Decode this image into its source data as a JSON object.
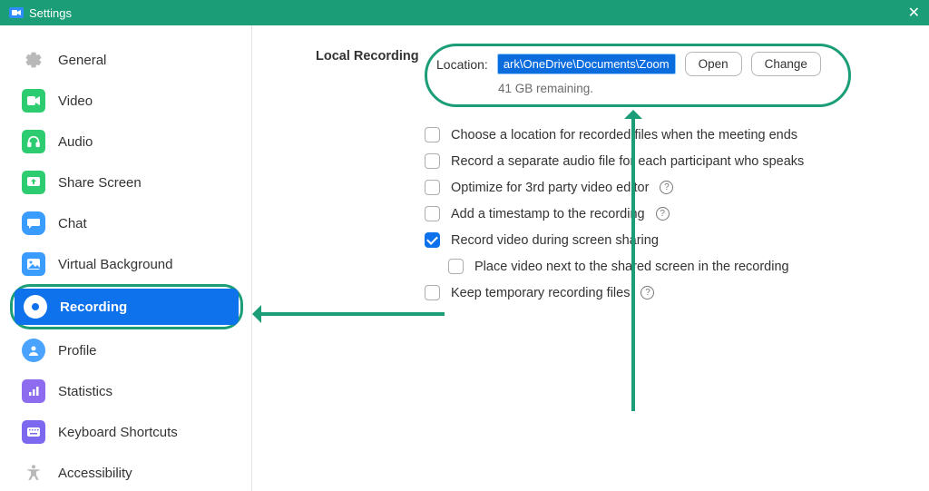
{
  "title": "Settings",
  "sidebar": {
    "items": [
      {
        "label": "General"
      },
      {
        "label": "Video"
      },
      {
        "label": "Audio"
      },
      {
        "label": "Share Screen"
      },
      {
        "label": "Chat"
      },
      {
        "label": "Virtual Background"
      },
      {
        "label": "Recording"
      },
      {
        "label": "Profile"
      },
      {
        "label": "Statistics"
      },
      {
        "label": "Keyboard Shortcuts"
      },
      {
        "label": "Accessibility"
      }
    ]
  },
  "main": {
    "section_title": "Local Recording",
    "location_label": "Location:",
    "location_path": "ark\\OneDrive\\Documents\\Zoom",
    "open_btn": "Open",
    "change_btn": "Change",
    "remaining": "41 GB remaining.",
    "opts": [
      "Choose a location for recorded files when the meeting ends",
      "Record a separate audio file for each participant who speaks",
      "Optimize for 3rd party video editor",
      "Add a timestamp to the recording",
      "Record video during screen sharing",
      "Place video next to the shared screen in the recording",
      "Keep temporary recording files"
    ]
  }
}
